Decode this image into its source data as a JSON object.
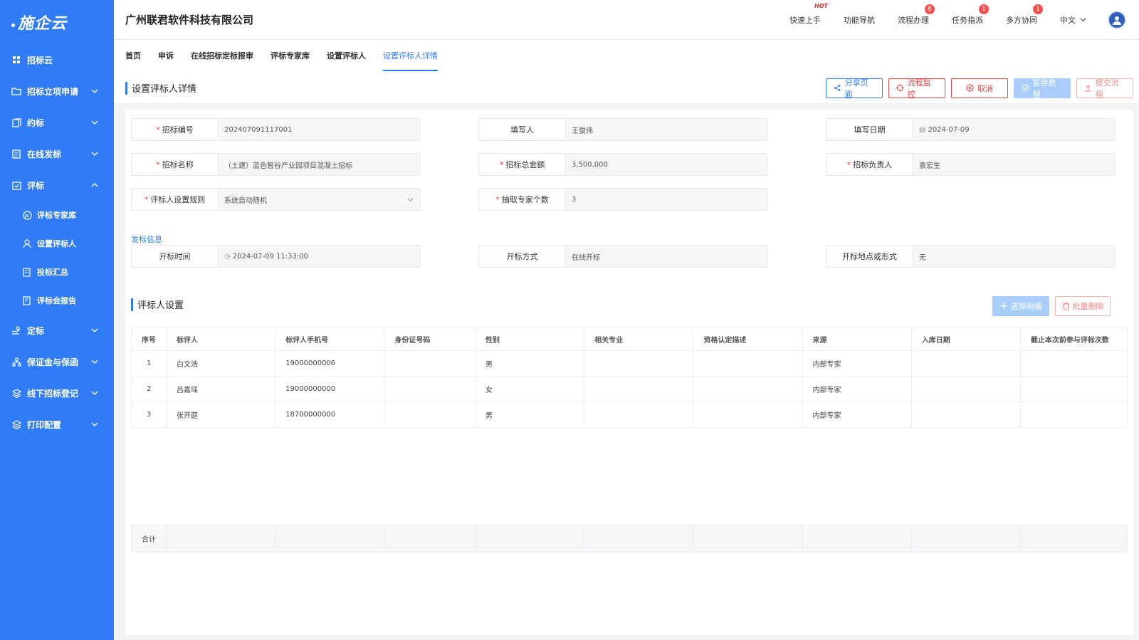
{
  "app": {
    "logo": "施企云",
    "company": "广州联君软件科技有限公司"
  },
  "sidebar": {
    "items": [
      {
        "label": "招标云",
        "icon": "grid-icon",
        "expandable": false
      },
      {
        "label": "招标立项申请",
        "icon": "folder-icon",
        "expandable": true
      },
      {
        "label": "约标",
        "icon": "book-icon",
        "expandable": true
      },
      {
        "label": "在线发标",
        "icon": "document-icon",
        "expandable": true
      },
      {
        "label": "评标",
        "icon": "checklist-icon",
        "expandable": true,
        "expanded": true
      }
    ],
    "sub_items": [
      {
        "label": "评标专家库",
        "icon": "expert-icon"
      },
      {
        "label": "设置评标人",
        "icon": "user-settings-icon"
      },
      {
        "label": "投标汇总",
        "icon": "summary-icon"
      },
      {
        "label": "评标会报告",
        "icon": "report-icon"
      }
    ],
    "items_after": [
      {
        "label": "定标",
        "icon": "hand-icon"
      },
      {
        "label": "保证金与保函",
        "icon": "org-icon"
      },
      {
        "label": "线下招标登记",
        "icon": "layers-icon"
      },
      {
        "label": "打印配置",
        "icon": "layers-icon"
      }
    ]
  },
  "header": {
    "links": [
      {
        "label": "快速上手",
        "hot": "HOT"
      },
      {
        "label": "功能导航"
      },
      {
        "label": "流程办理",
        "badge": "8"
      },
      {
        "label": "任务指派",
        "badge": "1"
      },
      {
        "label": "多方协同",
        "badge": "1"
      }
    ],
    "lang": "中文"
  },
  "tabs": [
    {
      "label": "首页"
    },
    {
      "label": "申诉"
    },
    {
      "label": "在线招标定标报审"
    },
    {
      "label": "评标专家库"
    },
    {
      "label": "设置评标人"
    },
    {
      "label": "设置评标人详情",
      "active": true
    }
  ],
  "titlebar": {
    "title": "设置评标人详情",
    "buttons": {
      "share": "分享页面",
      "monitor": "流程监控",
      "cancel": "取消",
      "save": "暂存数据",
      "submit": "提交流程"
    }
  },
  "form": {
    "bid_no": {
      "label": "招标编号",
      "value": "202407091117001",
      "required": true
    },
    "writer": {
      "label": "填写人",
      "value": "王俊伟"
    },
    "date": {
      "label": "填写日期",
      "value": "2024-07-09"
    },
    "bid_name": {
      "label": "招标名称",
      "value": "（土建）蓝色智谷产业园项目混凝土招标",
      "required": true
    },
    "amount": {
      "label": "招标总金额",
      "value": "3,500,000",
      "required": true
    },
    "manager": {
      "label": "招标负责人",
      "value": "袁宏生",
      "required": true
    },
    "rule": {
      "label": "评标人设置规则",
      "value": "系统自动随机",
      "required": true
    },
    "expert_count": {
      "label": "抽取专家个数",
      "value": "3",
      "required": true
    }
  },
  "publish": {
    "section_label": "发标信息",
    "open_time": {
      "label": "开标时间",
      "value": "2024-07-09 11:33:00"
    },
    "open_method": {
      "label": "开标方式",
      "value": "在线开标"
    },
    "open_place": {
      "label": "开标地点或形式",
      "value": "无"
    }
  },
  "evaluators": {
    "title": "评标人设置",
    "select_button": "选择明细",
    "delete_button": "批量删除",
    "columns": [
      "序号",
      "标评人",
      "标评人手机号",
      "身份证号码",
      "性别",
      "相关专业",
      "资格认定描述",
      "来源",
      "入库日期",
      "截止本次前参与评标次数"
    ],
    "rows": [
      {
        "no": "1",
        "name": "白文浩",
        "phone": "19000000006",
        "id": "",
        "gender": "男",
        "major": "",
        "qual": "",
        "source": "内部专家",
        "date": "",
        "count": ""
      },
      {
        "no": "2",
        "name": "吕嘉瑶",
        "phone": "19000000000",
        "id": "",
        "gender": "女",
        "major": "",
        "qual": "",
        "source": "内部专家",
        "date": "",
        "count": ""
      },
      {
        "no": "3",
        "name": "张开庭",
        "phone": "18700000000",
        "id": "",
        "gender": "男",
        "major": "",
        "qual": "",
        "source": "内部专家",
        "date": "",
        "count": ""
      }
    ],
    "total_label": "合计"
  },
  "colors": {
    "primary": "#2f7cf6",
    "danger": "#e54545",
    "sidebar": "#2f7cf6"
  }
}
